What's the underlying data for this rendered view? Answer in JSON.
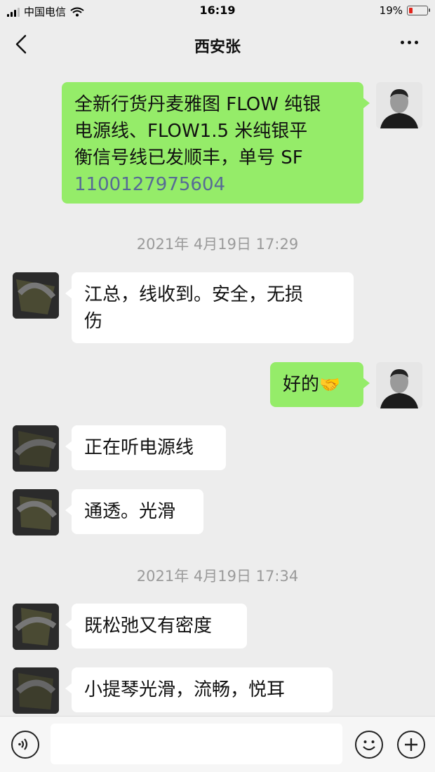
{
  "status_bar": {
    "carrier": "中国电信",
    "time": "16:19",
    "battery": "19%",
    "battery_level": 0.19
  },
  "header": {
    "title": "西安张",
    "back_icon": "chevron-left-icon",
    "more_icon": "more-dots-icon"
  },
  "messages": [
    {
      "side": "out",
      "lines": [
        "全新行货丹麦雅图 FLOW 纯银",
        "电源线、FLOW1.5 米纯银平",
        "衡信号线已发顺丰，单号 SF"
      ],
      "link": "1100127975604"
    },
    {
      "type": "time",
      "text": "2021年 4月19日 17:29"
    },
    {
      "side": "in",
      "lines": [
        "江总，线收到。安全，无损",
        "伤"
      ]
    },
    {
      "side": "out",
      "text": "好的",
      "emoji": "🤝"
    },
    {
      "side": "in",
      "text": "正在听电源线"
    },
    {
      "side": "in",
      "text": "通透。光滑"
    },
    {
      "type": "time",
      "text": "2021年 4月19日 17:34"
    },
    {
      "side": "in",
      "text": "既松弛又有密度"
    },
    {
      "side": "in",
      "text": "小提琴光滑，流畅，悦耳"
    }
  ],
  "input_bar": {
    "voice_icon": "voice-icon",
    "emoji_icon": "emoji-icon",
    "plus_icon": "plus-icon",
    "placeholder": ""
  },
  "colors": {
    "background": "#ededed",
    "outgoing_bubble": "#95ec69",
    "incoming_bubble": "#ffffff",
    "link": "#576b95"
  }
}
